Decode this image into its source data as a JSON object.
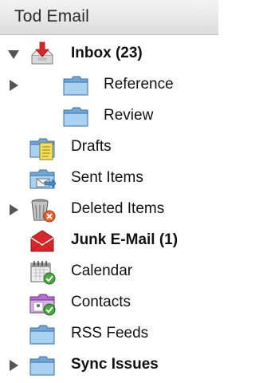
{
  "header": {
    "title": "Tod Email"
  },
  "folders": [
    {
      "label": "Inbox (23)",
      "icon": "inbox-icon",
      "bold": true,
      "expanded": true
    },
    {
      "label": "Reference",
      "icon": "folder-icon"
    },
    {
      "label": "Review",
      "icon": "folder-icon"
    },
    {
      "label": "Drafts",
      "icon": "drafts-icon"
    },
    {
      "label": "Sent Items",
      "icon": "sent-items-icon"
    },
    {
      "label": "Deleted Items",
      "icon": "deleted-items-icon",
      "collapsed": true
    },
    {
      "label": "Junk E-Mail (1)",
      "icon": "junk-mail-icon",
      "bold": true
    },
    {
      "label": "Calendar",
      "icon": "calendar-icon"
    },
    {
      "label": "Contacts",
      "icon": "contacts-icon"
    },
    {
      "label": "RSS Feeds",
      "icon": "rss-folder-icon"
    },
    {
      "label": "Sync Issues",
      "icon": "folder-icon",
      "bold": true,
      "collapsed": true
    }
  ]
}
